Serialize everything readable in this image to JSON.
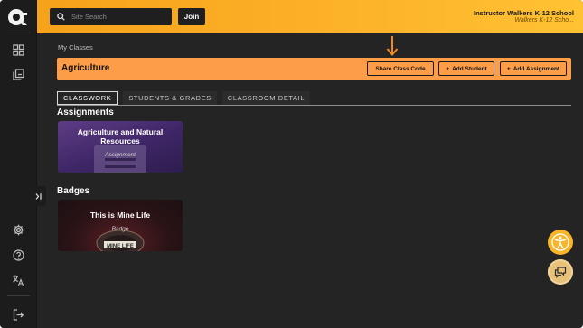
{
  "topbar": {
    "search_placeholder": "Site Search",
    "join_label": "Join",
    "user_name": "Instructor Walkers K-12 School",
    "user_school": "Walkers K-12 Scho..."
  },
  "sidebar": {
    "icons": [
      "dashboard-icon",
      "library-icon",
      "settings-icon",
      "help-icon",
      "translate-icon",
      "logout-icon"
    ]
  },
  "main": {
    "breadcrumb": "My Classes",
    "class_title": "Agriculture",
    "buttons": {
      "share": "Share Class Code",
      "add_student": "Add Student",
      "add_assignment": "Add Assignment"
    },
    "tabs": [
      {
        "label": "CLASSWORK"
      },
      {
        "label": "STUDENTS & GRADES"
      },
      {
        "label": "CLASSROOM DETAIL"
      }
    ],
    "assignments_heading": "Assignments",
    "assignment_card": {
      "title": "Agriculture and Natural Resources",
      "type": "Assignment"
    },
    "badges_heading": "Badges",
    "badge_card": {
      "title": "This is Mine Life",
      "type": "Badge",
      "art_text": "MINE LIFE"
    }
  },
  "colors": {
    "accent": "#fdb32a",
    "class_bar": "#fd9d48",
    "arrow": "#f28a1e"
  }
}
